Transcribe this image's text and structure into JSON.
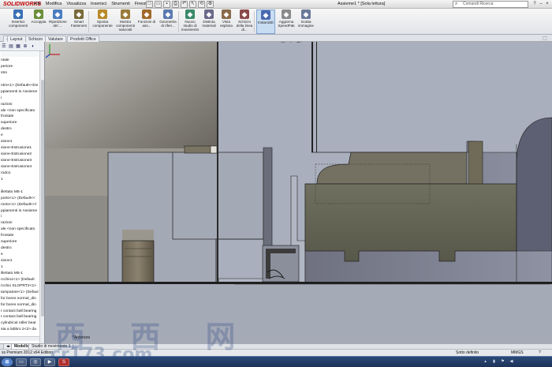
{
  "app": {
    "logo": "SOLIDWORKS",
    "doc_title": "Assieme1 * [Sola lettura]",
    "menus": [
      "File",
      "Modifica",
      "Visualizza",
      "Inserisci",
      "Strumenti",
      "Finestra"
    ],
    "search_placeholder": "Comandi Ricerca"
  },
  "ribbon": {
    "buttons": [
      {
        "label": "Inserisci componenti",
        "icon": "insert-components-icon",
        "color": "#3a6fb5"
      },
      {
        "label": "Accoppia",
        "icon": "mate-icon",
        "color": "#6b8e3a"
      },
      {
        "label": "Ripetizione del ...",
        "icon": "pattern-icon",
        "color": "#4b7cc0"
      },
      {
        "label": "Smart Fasteners",
        "icon": "smart-fasteners-icon",
        "color": "#7a6a3a"
      },
      {
        "label": "Sposta componente",
        "icon": "move-component-icon",
        "color": "#b88a2a"
      },
      {
        "label": "Mostra componenti nascosti",
        "icon": "show-hidden-icon",
        "color": "#9a7a3a"
      },
      {
        "label": "Funzioni di ass...",
        "icon": "assembly-features-icon",
        "color": "#a06a2a"
      },
      {
        "label": "Geometria di riferi...",
        "icon": "reference-geometry-icon",
        "color": "#5a7ab0"
      },
      {
        "label": "Nuovo studio di movimento",
        "icon": "motion-study-icon",
        "color": "#3a8a6a"
      },
      {
        "label": "Distinta materiali",
        "icon": "bom-icon",
        "color": "#6a6a8a"
      },
      {
        "label": "Vista esplosa",
        "icon": "exploded-view-icon",
        "color": "#8a6a4a"
      },
      {
        "label": "Schizzo della linea di...",
        "icon": "explode-line-icon",
        "color": "#8a4a4a"
      },
      {
        "label": "Instant3D",
        "icon": "instant3d-icon",
        "color": "#4a6ab0"
      },
      {
        "label": "Aggiorna SpeedPak",
        "icon": "speedpak-icon",
        "color": "#8a8a8a"
      },
      {
        "label": "Scatta immagine",
        "icon": "snapshot-icon",
        "color": "#6a7a9a"
      }
    ]
  },
  "tabs": [
    "Layout",
    "Schizzo",
    "Valutare",
    "Prodotti Office"
  ],
  "tree": {
    "items": [
      "ntale",
      "periore",
      "stro",
      "",
      "ntro<1> (Default<<De",
      "ppiamenti in Assieme",
      "i",
      "razioni",
      "ale <non specificato",
      "frontale",
      "superiore",
      "destro",
      "e",
      "sione1",
      "sione-Estrusione1",
      "sione-Estrusione2",
      "sione-Estrusione3",
      "sione-Estrusione4",
      "rodo1",
      "1",
      "",
      "illettato M5-1",
      "porto<1> (Default<<",
      "ronto<1> (Default<<l",
      "ppiamenti in Assieme",
      "i",
      "razioni",
      "ale <non specificato",
      "frontale",
      "superiore",
      "destro",
      "e",
      "sione1",
      "1",
      "illettato M5-1",
      "rcchio1<1> (Default",
      "rcchio SLOPRT2<1>",
      "tampatore<1> (Defaul",
      "for bores normal_din",
      "for bores normal_din",
      "r contact ball bearing",
      "r contact ball bearing",
      "cylindrical roller bear",
      "sta a labbro 2<2> da"
    ]
  },
  "viewport": {
    "view_label": "*Anteriore",
    "background": "#a2a8b6"
  },
  "bottom_tabs": [
    "Modello",
    "Studio di movimento 1"
  ],
  "status": {
    "left": "ss Premium 2012 x64 Edition",
    "definition": "Sotto definito",
    "units": "MMGS"
  },
  "watermark": {
    "cn": "西 西 网",
    "url": "cr173.com"
  },
  "clock": {
    "time": "",
    "date": ""
  }
}
